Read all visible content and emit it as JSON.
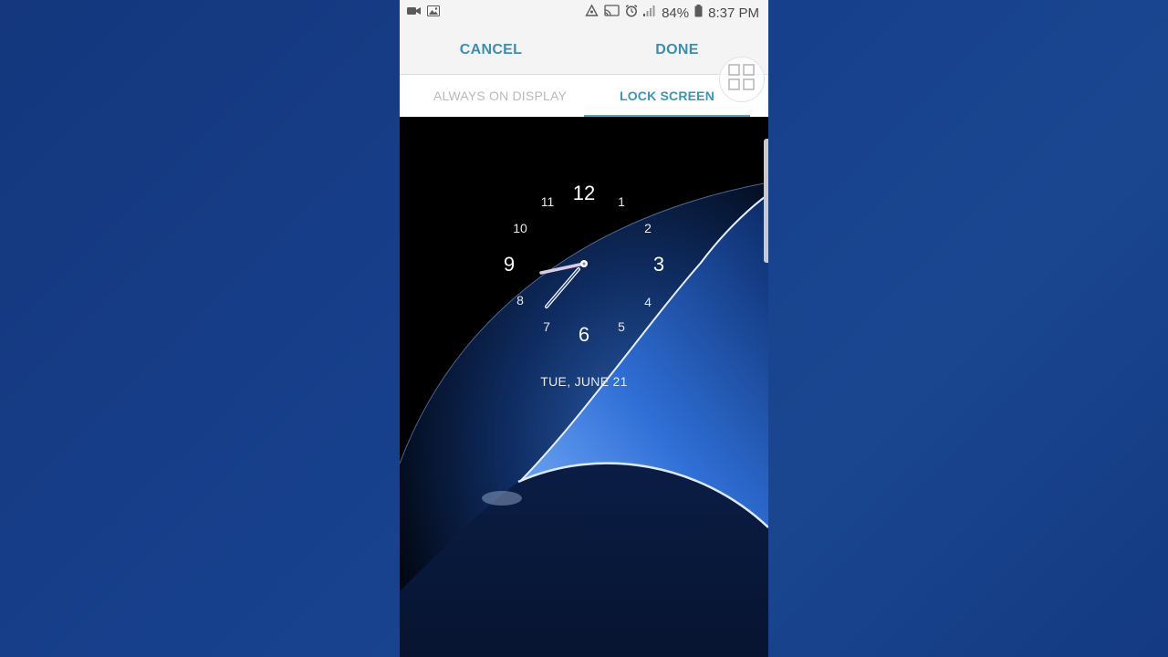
{
  "statusbar": {
    "battery": "84%",
    "time": "8:37 PM",
    "left_icons": [
      "video-camera-icon",
      "gallery-icon"
    ],
    "right_icons": [
      "recycle-icon",
      "cast-icon",
      "alarm-icon",
      "signal-icon",
      "battery-icon"
    ]
  },
  "header": {
    "cancel_label": "CANCEL",
    "done_label": "DONE"
  },
  "tabs": [
    {
      "label": "ALWAYS ON DISPLAY",
      "selected": false
    },
    {
      "label": "LOCK SCREEN",
      "selected": true
    }
  ],
  "clock": {
    "numerals": [
      "12",
      "1",
      "2",
      "3",
      "4",
      "5",
      "6",
      "7",
      "8",
      "9",
      "10",
      "11"
    ],
    "date": "TUE, JUNE 21"
  },
  "colors": {
    "accent": "#3a8fb0",
    "background": "#133a82",
    "header_bg": "#f4f4f4"
  }
}
